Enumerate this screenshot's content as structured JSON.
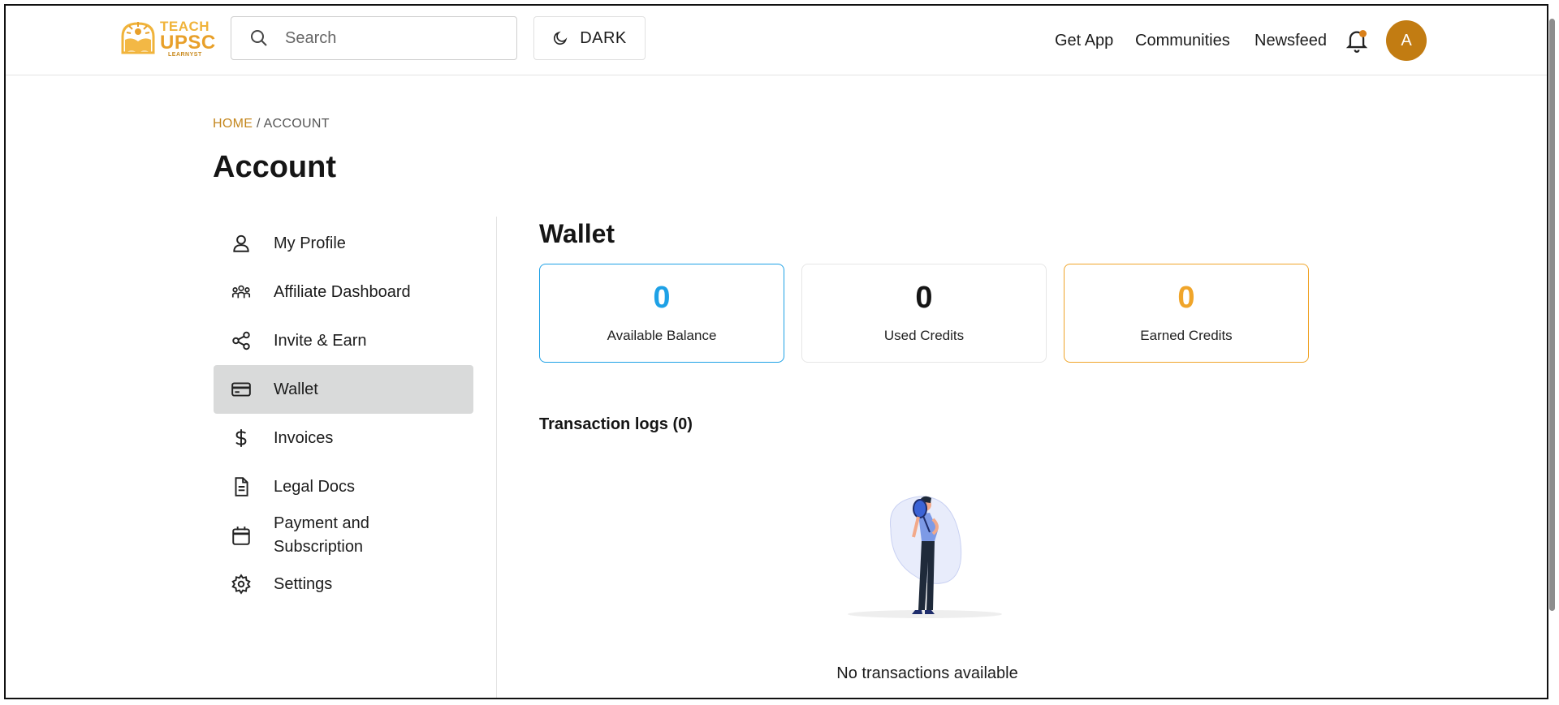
{
  "header": {
    "logo": {
      "line1": "TEACH",
      "line2": "UPSC",
      "line3": "LEARNYST"
    },
    "search": {
      "placeholder": "Search"
    },
    "theme_toggle": {
      "label": "DARK",
      "icon": "moon-icon"
    },
    "nav": [
      "Get App",
      "Communities",
      "Newsfeed"
    ],
    "notification_icon": "bell-icon",
    "avatar_letter": "A",
    "colors": {
      "brand": "#e8a02a",
      "avatar": "#c27c12",
      "notification_dot": "#d9801a"
    }
  },
  "breadcrumb": {
    "home": "HOME",
    "separator": "/",
    "current": "ACCOUNT"
  },
  "page_title": "Account",
  "sidebar": {
    "items": [
      {
        "label": "My Profile",
        "icon": "user-icon",
        "active": false
      },
      {
        "label": "Affiliate Dashboard",
        "icon": "people-group-icon",
        "active": false
      },
      {
        "label": "Invite & Earn",
        "icon": "share-icon",
        "active": false
      },
      {
        "label": "Wallet",
        "icon": "credit-card-icon",
        "active": true
      },
      {
        "label": "Invoices",
        "icon": "dollar-icon",
        "active": false
      },
      {
        "label": "Legal Docs",
        "icon": "document-icon",
        "active": false
      },
      {
        "label": "Payment and",
        "label2": "Subscription",
        "icon": "calendar-icon",
        "active": false
      },
      {
        "label": "Settings",
        "icon": "gear-icon",
        "active": false
      }
    ]
  },
  "wallet": {
    "title": "Wallet",
    "cards": [
      {
        "value": "0",
        "label": "Available Balance",
        "color": "#1ea1e6"
      },
      {
        "value": "0",
        "label": "Used Credits",
        "color": "#151515"
      },
      {
        "value": "0",
        "label": "Earned Credits",
        "color": "#f0a52a"
      }
    ],
    "transactions_title": "Transaction logs (0)",
    "empty_message": "No transactions available"
  }
}
